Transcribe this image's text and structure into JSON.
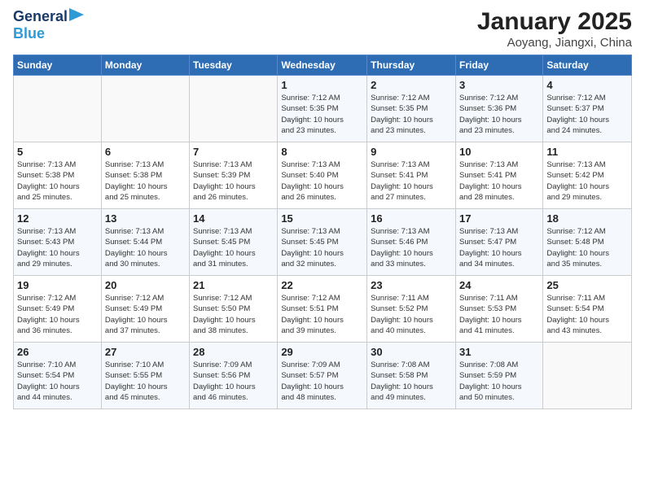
{
  "header": {
    "logo_general": "General",
    "logo_blue": "Blue",
    "title": "January 2025",
    "subtitle": "Aoyang, Jiangxi, China"
  },
  "weekdays": [
    "Sunday",
    "Monday",
    "Tuesday",
    "Wednesday",
    "Thursday",
    "Friday",
    "Saturday"
  ],
  "weeks": [
    [
      {
        "day": "",
        "info": ""
      },
      {
        "day": "",
        "info": ""
      },
      {
        "day": "",
        "info": ""
      },
      {
        "day": "1",
        "info": "Sunrise: 7:12 AM\nSunset: 5:35 PM\nDaylight: 10 hours\nand 23 minutes."
      },
      {
        "day": "2",
        "info": "Sunrise: 7:12 AM\nSunset: 5:35 PM\nDaylight: 10 hours\nand 23 minutes."
      },
      {
        "day": "3",
        "info": "Sunrise: 7:12 AM\nSunset: 5:36 PM\nDaylight: 10 hours\nand 23 minutes."
      },
      {
        "day": "4",
        "info": "Sunrise: 7:12 AM\nSunset: 5:37 PM\nDaylight: 10 hours\nand 24 minutes."
      }
    ],
    [
      {
        "day": "5",
        "info": "Sunrise: 7:13 AM\nSunset: 5:38 PM\nDaylight: 10 hours\nand 25 minutes."
      },
      {
        "day": "6",
        "info": "Sunrise: 7:13 AM\nSunset: 5:38 PM\nDaylight: 10 hours\nand 25 minutes."
      },
      {
        "day": "7",
        "info": "Sunrise: 7:13 AM\nSunset: 5:39 PM\nDaylight: 10 hours\nand 26 minutes."
      },
      {
        "day": "8",
        "info": "Sunrise: 7:13 AM\nSunset: 5:40 PM\nDaylight: 10 hours\nand 26 minutes."
      },
      {
        "day": "9",
        "info": "Sunrise: 7:13 AM\nSunset: 5:41 PM\nDaylight: 10 hours\nand 27 minutes."
      },
      {
        "day": "10",
        "info": "Sunrise: 7:13 AM\nSunset: 5:41 PM\nDaylight: 10 hours\nand 28 minutes."
      },
      {
        "day": "11",
        "info": "Sunrise: 7:13 AM\nSunset: 5:42 PM\nDaylight: 10 hours\nand 29 minutes."
      }
    ],
    [
      {
        "day": "12",
        "info": "Sunrise: 7:13 AM\nSunset: 5:43 PM\nDaylight: 10 hours\nand 29 minutes."
      },
      {
        "day": "13",
        "info": "Sunrise: 7:13 AM\nSunset: 5:44 PM\nDaylight: 10 hours\nand 30 minutes."
      },
      {
        "day": "14",
        "info": "Sunrise: 7:13 AM\nSunset: 5:45 PM\nDaylight: 10 hours\nand 31 minutes."
      },
      {
        "day": "15",
        "info": "Sunrise: 7:13 AM\nSunset: 5:45 PM\nDaylight: 10 hours\nand 32 minutes."
      },
      {
        "day": "16",
        "info": "Sunrise: 7:13 AM\nSunset: 5:46 PM\nDaylight: 10 hours\nand 33 minutes."
      },
      {
        "day": "17",
        "info": "Sunrise: 7:13 AM\nSunset: 5:47 PM\nDaylight: 10 hours\nand 34 minutes."
      },
      {
        "day": "18",
        "info": "Sunrise: 7:12 AM\nSunset: 5:48 PM\nDaylight: 10 hours\nand 35 minutes."
      }
    ],
    [
      {
        "day": "19",
        "info": "Sunrise: 7:12 AM\nSunset: 5:49 PM\nDaylight: 10 hours\nand 36 minutes."
      },
      {
        "day": "20",
        "info": "Sunrise: 7:12 AM\nSunset: 5:49 PM\nDaylight: 10 hours\nand 37 minutes."
      },
      {
        "day": "21",
        "info": "Sunrise: 7:12 AM\nSunset: 5:50 PM\nDaylight: 10 hours\nand 38 minutes."
      },
      {
        "day": "22",
        "info": "Sunrise: 7:12 AM\nSunset: 5:51 PM\nDaylight: 10 hours\nand 39 minutes."
      },
      {
        "day": "23",
        "info": "Sunrise: 7:11 AM\nSunset: 5:52 PM\nDaylight: 10 hours\nand 40 minutes."
      },
      {
        "day": "24",
        "info": "Sunrise: 7:11 AM\nSunset: 5:53 PM\nDaylight: 10 hours\nand 41 minutes."
      },
      {
        "day": "25",
        "info": "Sunrise: 7:11 AM\nSunset: 5:54 PM\nDaylight: 10 hours\nand 43 minutes."
      }
    ],
    [
      {
        "day": "26",
        "info": "Sunrise: 7:10 AM\nSunset: 5:54 PM\nDaylight: 10 hours\nand 44 minutes."
      },
      {
        "day": "27",
        "info": "Sunrise: 7:10 AM\nSunset: 5:55 PM\nDaylight: 10 hours\nand 45 minutes."
      },
      {
        "day": "28",
        "info": "Sunrise: 7:09 AM\nSunset: 5:56 PM\nDaylight: 10 hours\nand 46 minutes."
      },
      {
        "day": "29",
        "info": "Sunrise: 7:09 AM\nSunset: 5:57 PM\nDaylight: 10 hours\nand 48 minutes."
      },
      {
        "day": "30",
        "info": "Sunrise: 7:08 AM\nSunset: 5:58 PM\nDaylight: 10 hours\nand 49 minutes."
      },
      {
        "day": "31",
        "info": "Sunrise: 7:08 AM\nSunset: 5:59 PM\nDaylight: 10 hours\nand 50 minutes."
      },
      {
        "day": "",
        "info": ""
      }
    ]
  ]
}
